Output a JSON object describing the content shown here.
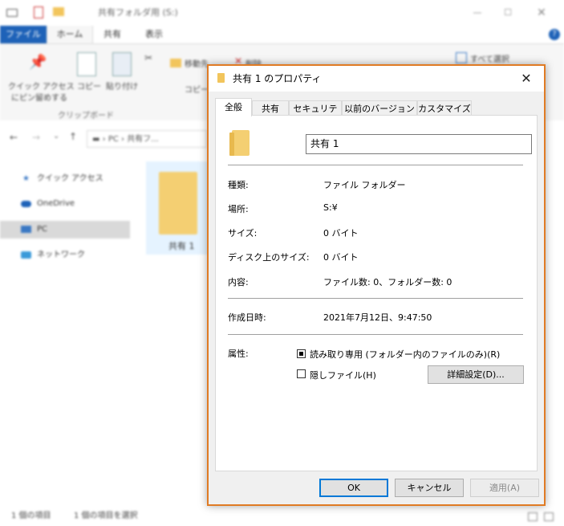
{
  "explorer": {
    "window_title": "共有フォルダ用 (S:)",
    "ribbon_tabs": [
      "ファイル",
      "ホーム",
      "共有",
      "表示"
    ],
    "ribbon_buttons": {
      "quick_access": "クイック アクセス",
      "pin": "にピン留めする",
      "copy": "コピー",
      "paste": "貼り付け",
      "clipboard_group": "クリップボード",
      "move_to": "移動先",
      "delete": "削除",
      "copy_to": "コピー",
      "select_all": "すべて選択"
    },
    "address_path": [
      "PC",
      "共有フ..."
    ],
    "nav_items": [
      "クイック アクセス",
      "OneDrive",
      "PC",
      "ネットワーク"
    ],
    "selected_nav": "PC",
    "folder_item": "共有 1",
    "status_items": "1 個の項目",
    "status_selected": "1 個の項目を選択"
  },
  "dialog": {
    "title": "共有 1 のプロパティ",
    "tabs": [
      "全般",
      "共有",
      "セキュリティ",
      "以前のバージョン",
      "カスタマイズ"
    ],
    "active_tab": "全般",
    "folder_name": "共有 1",
    "properties": {
      "type_label": "種類:",
      "type_value": "ファイル フォルダー",
      "location_label": "場所:",
      "location_value": "S:¥",
      "size_label": "サイズ:",
      "size_value": "0 バイト",
      "disk_size_label": "ディスク上のサイズ:",
      "disk_size_value": "0 バイト",
      "contains_label": "内容:",
      "contains_value": "ファイル数: 0、フォルダー数: 0",
      "created_label": "作成日時:",
      "created_value": "2021年7月12日、9:47:50",
      "attributes_label": "属性:"
    },
    "attributes": {
      "readonly_label": "読み取り専用 (フォルダー内のファイルのみ)(R)",
      "readonly_checked": true,
      "hidden_label": "隠しファイル(H)",
      "hidden_checked": false,
      "advanced_button": "詳細設定(D)..."
    },
    "buttons": {
      "ok": "OK",
      "cancel": "キャンセル",
      "apply": "適用(A)"
    }
  },
  "colors": {
    "dialog_border": "#e07b24",
    "file_tab": "#1e62b8",
    "folder": "#f4cf72",
    "default_button_border": "#0078d7"
  }
}
